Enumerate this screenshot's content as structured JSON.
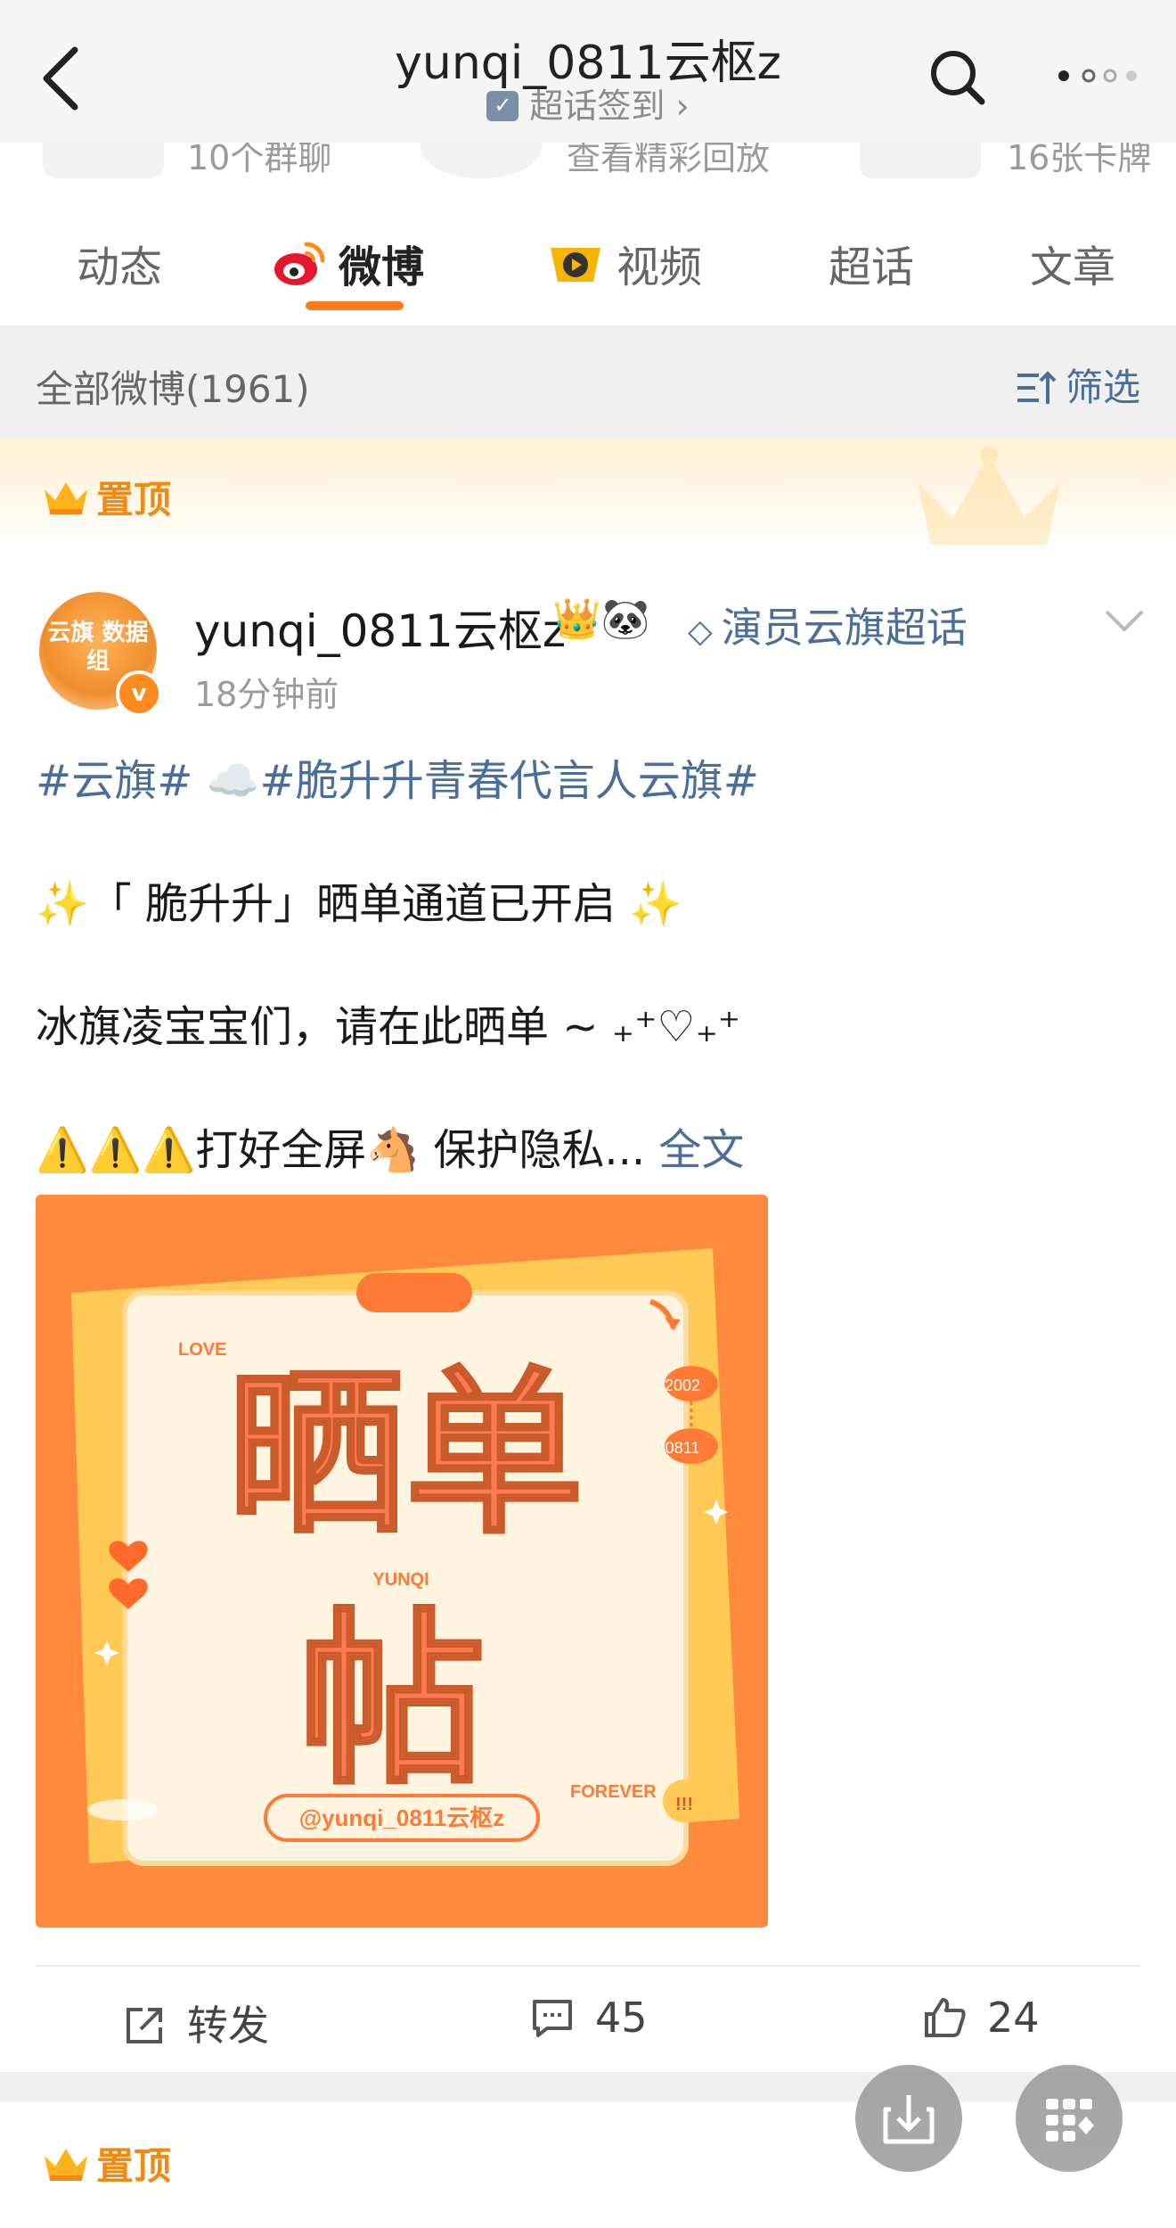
{
  "header": {
    "title": "yunqi_0811云枢z",
    "subtitle": "超话签到 ›"
  },
  "strip": {
    "items": [
      "10个群聊",
      "查看精彩回放",
      "16张卡牌"
    ]
  },
  "tabs": [
    {
      "label": "动态"
    },
    {
      "label": "微博"
    },
    {
      "label": "视频"
    },
    {
      "label": "超话"
    },
    {
      "label": "文章"
    }
  ],
  "filter": {
    "count_label": "全部微博(1961)",
    "button_label": "筛选"
  },
  "pinned": {
    "label": "置顶"
  },
  "post": {
    "avatar_text": "云旗 数据组",
    "username": "yunqi_0811云枢z",
    "badges": "👑🐼",
    "supertopic": "演员云旗超话",
    "time": "18分钟前",
    "hashtag1": "#云旗#",
    "cloud_emoji": "☁️",
    "hashtag2": "#脆升升青春代言人云旗#",
    "line2": "✨「 脆升升」晒单通道已开启 ✨",
    "line3": "冰旗凌宝宝们，请在此晒单 ~ ₊⁺♡₊⁺",
    "line4": "⚠️⚠️⚠️打好全屏🐴 保护隐私...",
    "fulltext": "全文",
    "image": {
      "love": "LOVE",
      "big1": "晒单",
      "yunqi": "YUNQI",
      "big2": "帖",
      "tag1": "2002",
      "tag2": "0811",
      "forever": "FOREVER",
      "handle": "@yunqi_0811云枢z",
      "exclaim": "!!!"
    },
    "actions": {
      "repost_label": "转发",
      "comment_count": "45",
      "like_count": "24"
    }
  },
  "pinned2": {
    "label": "置顶"
  },
  "colors": {
    "accent_orange": "#ff7a1a",
    "link_blue": "#4a6e9a",
    "pinned_gold": "#f08a12"
  }
}
